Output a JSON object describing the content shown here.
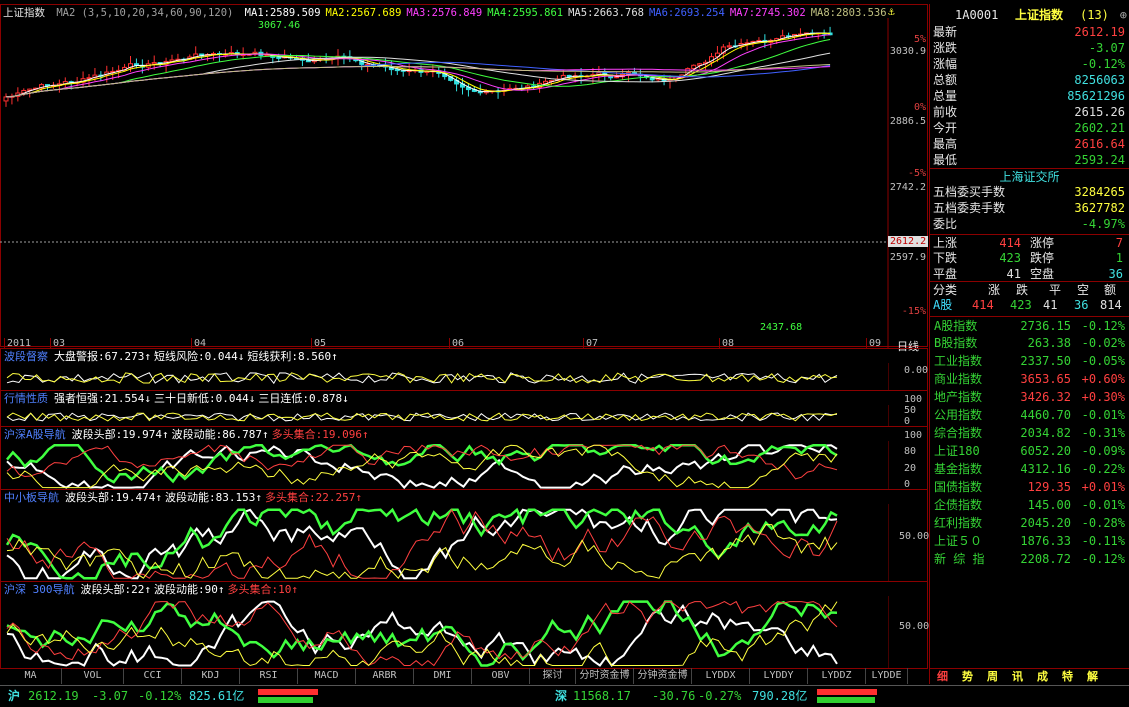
{
  "main_chart": {
    "title": "上证指数",
    "ma_params": "MA2 (3,5,10,20,34,60,90,120)",
    "ma": [
      {
        "label": "MA1:2589.509",
        "color": "#ffffff"
      },
      {
        "label": "MA2:2567.689",
        "color": "#ffff00"
      },
      {
        "label": "MA3:2576.849",
        "color": "#ff40ff"
      },
      {
        "label": "MA4:2595.861",
        "color": "#40ff40"
      },
      {
        "label": "MA5:2663.768",
        "color": "#e0e0e0"
      },
      {
        "label": "MA6:2693.254",
        "color": "#4060ff"
      },
      {
        "label": "MA7:2745.302",
        "color": "#ff40ff"
      },
      {
        "label": "MA8:2803.536",
        "color": "#c0c080"
      }
    ],
    "high_label": "3067.46",
    "low_label": "2437.68",
    "current_price_tag": "2612.2",
    "price_axis": [
      "5%",
      "3030.9",
      "0%",
      "2886.5",
      "-5%",
      "2742.2",
      "2597.9",
      "-15%"
    ],
    "date_axis": [
      "2011",
      "03",
      "04",
      "05",
      "06",
      "07",
      "08",
      "09"
    ],
    "period_label": "日线"
  },
  "indicators": [
    {
      "name": "波段督察",
      "items": [
        {
          "text": "大盘警报:67.273↑",
          "color": "#ffffff"
        },
        {
          "text": "短线风险:0.044↓",
          "color": "#ffffff"
        },
        {
          "text": "短线获利:8.560↑",
          "color": "#ffffff"
        }
      ],
      "axis": [
        "0.00"
      ]
    },
    {
      "name": "行情性质",
      "items": [
        {
          "text": "强者恒强:21.554↓",
          "color": "#ffffff"
        },
        {
          "text": "三十日新低:0.044↓",
          "color": "#ffffff"
        },
        {
          "text": "三日连低:0.878↓",
          "color": "#ffffff"
        }
      ],
      "axis": [
        "100",
        "50",
        "0"
      ]
    },
    {
      "name": "沪深A股导航",
      "items": [
        {
          "text": "波段头部:19.974↑",
          "color": "#ffffff"
        },
        {
          "text": "波段动能:86.787↑",
          "color": "#ffffff"
        },
        {
          "text": "多头集合:19.096↑",
          "color": "#ff4040"
        }
      ],
      "axis": [
        "100",
        "80",
        "20",
        "0"
      ]
    },
    {
      "name": "中小板导航",
      "items": [
        {
          "text": "波段头部:19.474↑",
          "color": "#ffffff"
        },
        {
          "text": "波段动能:83.153↑",
          "color": "#ffffff"
        },
        {
          "text": "多头集合:22.257↑",
          "color": "#ff4040"
        }
      ],
      "axis": [
        "50.00"
      ]
    },
    {
      "name": "沪深 300导航",
      "items": [
        {
          "text": "波段头部:22↑",
          "color": "#ffffff"
        },
        {
          "text": "波段动能:90↑",
          "color": "#ffffff"
        },
        {
          "text": "多头集合:10↑",
          "color": "#ff4040"
        }
      ],
      "axis": [
        "50.00"
      ]
    }
  ],
  "bottom_tabs": [
    "MA",
    "VOL",
    "CCI",
    "KDJ",
    "RSI",
    "MACD",
    "ARBR",
    "DMI",
    "OBV",
    "探讨",
    "分时资金博",
    "分钟资金博",
    "LYDDX",
    "LYDDY",
    "LYDDZ",
    "LYDDE"
  ],
  "quote": {
    "code": "1A0001",
    "name": "上证指数",
    "count": "(13)",
    "fields": [
      {
        "label": "最新",
        "value": "2612.19",
        "color": "#ff4040"
      },
      {
        "label": "涨跌",
        "value": "-3.07",
        "color": "#35d435"
      },
      {
        "label": "涨幅",
        "value": "-0.12%",
        "color": "#35d435"
      },
      {
        "label": "总额",
        "value": "8256063",
        "color": "#40e0e0"
      },
      {
        "label": "总量",
        "value": "85621296",
        "color": "#40e0e0"
      },
      {
        "label": "前收",
        "value": "2615.26",
        "color": "#e0e0e0"
      },
      {
        "label": "今开",
        "value": "2602.21",
        "color": "#35d435"
      },
      {
        "label": "最高",
        "value": "2616.64",
        "color": "#ff4040"
      },
      {
        "label": "最低",
        "value": "2593.24",
        "color": "#35d435"
      }
    ],
    "exchange": "上海证交所",
    "book": [
      {
        "label": "五档委买手数",
        "value": "3284265",
        "color": "#ffff40"
      },
      {
        "label": "五档委卖手数",
        "value": "3627782",
        "color": "#ffff40"
      },
      {
        "label": "委比",
        "value": "-4.97%",
        "color": "#35d435"
      }
    ],
    "breadth": [
      {
        "l1": "上涨",
        "v1": "414",
        "c1": "#ff4040",
        "l2": "涨停",
        "v2": "7",
        "c2": "#ff4040"
      },
      {
        "l1": "下跌",
        "v1": "423",
        "c1": "#35d435",
        "l2": "跌停",
        "v2": "1",
        "c2": "#35d435"
      },
      {
        "l1": "平盘",
        "v1": "41",
        "c1": "#e0e0e0",
        "l2": "空盘",
        "v2": "36",
        "c2": "#40e0e0"
      }
    ],
    "class_header": [
      "分类",
      "涨",
      "跌",
      "平",
      "空",
      "额"
    ],
    "class_row": {
      "name": "A股",
      "up": "414",
      "down": "423",
      "flat": "41",
      "empty": "36",
      "amt": "814"
    },
    "indices": [
      {
        "name": "A股指数",
        "value": "2736.15",
        "pct": "-0.12%",
        "color": "#35d435"
      },
      {
        "name": "B股指数",
        "value": "263.38",
        "pct": "-0.02%",
        "color": "#35d435"
      },
      {
        "name": "工业指数",
        "value": "2337.50",
        "pct": "-0.05%",
        "color": "#35d435"
      },
      {
        "name": "商业指数",
        "value": "3653.65",
        "pct": "+0.60%",
        "color": "#ff4040"
      },
      {
        "name": "地产指数",
        "value": "3426.32",
        "pct": "+0.30%",
        "color": "#ff4040"
      },
      {
        "name": "公用指数",
        "value": "4460.70",
        "pct": "-0.01%",
        "color": "#35d435"
      },
      {
        "name": "综合指数",
        "value": "2034.82",
        "pct": "-0.31%",
        "color": "#35d435"
      },
      {
        "name": "上证180",
        "value": "6052.20",
        "pct": "-0.09%",
        "color": "#35d435"
      },
      {
        "name": "基金指数",
        "value": "4312.16",
        "pct": "-0.22%",
        "color": "#35d435"
      },
      {
        "name": "国债指数",
        "value": "129.35",
        "pct": "+0.01%",
        "color": "#ff4040"
      },
      {
        "name": "企债指数",
        "value": "145.00",
        "pct": "-0.01%",
        "color": "#35d435"
      },
      {
        "name": "红利指数",
        "value": "2045.20",
        "pct": "-0.28%",
        "color": "#35d435"
      },
      {
        "name": "上证５０",
        "value": "1876.33",
        "pct": "-0.11%",
        "color": "#35d435"
      },
      {
        "name": "新 综 指",
        "value": "2208.72",
        "pct": "-0.12%",
        "color": "#35d435"
      }
    ],
    "tabs": [
      "细",
      "势",
      "周",
      "讯",
      "成",
      "特",
      "解"
    ]
  },
  "status": {
    "sh_label": "沪",
    "sh_price": "2612.19",
    "sh_change": "-3.07",
    "sh_pct": "-0.12%",
    "sh_amount": "825.61亿",
    "sz_label": "深",
    "sz_price": "11568.17",
    "sz_change": "-30.76",
    "sz_pct": "-0.27%",
    "sz_amount": "790.28亿"
  }
}
